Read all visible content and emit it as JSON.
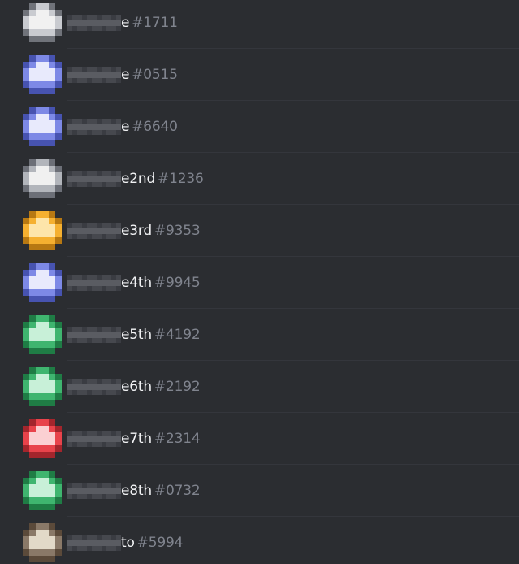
{
  "members": [
    {
      "name_suffix": "e",
      "discriminator": "#1711",
      "avatar_color": "#c9cbd0",
      "avatar_shade": "#70737a",
      "avatar_highlight": "#f1f1f1"
    },
    {
      "name_suffix": "e",
      "discriminator": "#0515",
      "avatar_color": "#7d89e6",
      "avatar_shade": "#4753b0",
      "avatar_highlight": "#e8eafc"
    },
    {
      "name_suffix": "e",
      "discriminator": "#6640",
      "avatar_color": "#7d89e6",
      "avatar_shade": "#4753b0",
      "avatar_highlight": "#e8eafc"
    },
    {
      "name_suffix": "e2nd",
      "discriminator": "#1236",
      "avatar_color": "#b2b5bb",
      "avatar_shade": "#6c6f77",
      "avatar_highlight": "#f0f0f0"
    },
    {
      "name_suffix": "e3rd",
      "discriminator": "#9353",
      "avatar_color": "#f5b030",
      "avatar_shade": "#b77812",
      "avatar_highlight": "#fde5aa"
    },
    {
      "name_suffix": "e4th",
      "discriminator": "#9945",
      "avatar_color": "#7d89e6",
      "avatar_shade": "#4753b0",
      "avatar_highlight": "#e8eafc"
    },
    {
      "name_suffix": "e5th",
      "discriminator": "#4192",
      "avatar_color": "#3fb56f",
      "avatar_shade": "#1f7c45",
      "avatar_highlight": "#c8f0d8"
    },
    {
      "name_suffix": "e6th",
      "discriminator": "#2192",
      "avatar_color": "#3fb56f",
      "avatar_shade": "#1f7c45",
      "avatar_highlight": "#c8f0d8"
    },
    {
      "name_suffix": "e7th",
      "discriminator": "#2314",
      "avatar_color": "#e8434b",
      "avatar_shade": "#a3252c",
      "avatar_highlight": "#fbd0d2"
    },
    {
      "name_suffix": "e8th",
      "discriminator": "#0732",
      "avatar_color": "#3fb56f",
      "avatar_shade": "#1f7c45",
      "avatar_highlight": "#c8f0d8"
    },
    {
      "name_suffix": "to",
      "discriminator": "#5994",
      "avatar_color": "#8a7968",
      "avatar_shade": "#5b4a3a",
      "avatar_highlight": "#e2d9c8"
    }
  ],
  "colors": {
    "background": "#2b2d31",
    "divider": "#34363c",
    "name_text": "#f2f3f5",
    "discriminator_text": "#80848e",
    "redaction_light": "#5a5c62",
    "redaction_dark": "#3a3c42"
  }
}
